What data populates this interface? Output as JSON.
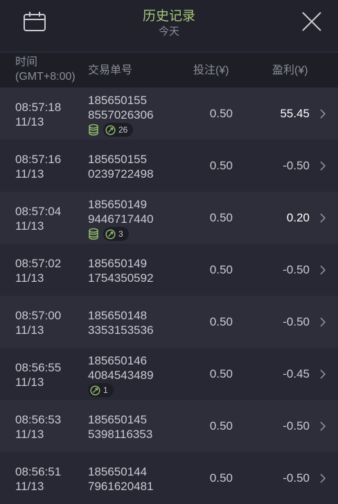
{
  "header": {
    "title": "历史记录",
    "subtitle": "今天",
    "left_icon": "calendar-icon",
    "right_icon": "close-icon"
  },
  "columns": {
    "time_line1": "时间",
    "time_line2": "(GMT+8:00)",
    "order": "交易单号",
    "stake": "投注(¥)",
    "profit": "盈利(¥)"
  },
  "colors": {
    "title": "#a6c87c",
    "background": "#21222b",
    "row_odd": "#2d2e3a",
    "row_even": "#272833",
    "badge_icon": "#8fb86a"
  },
  "rows": [
    {
      "time": "08:57:18",
      "date": "11/13",
      "order1": "185650155",
      "order2": "8557026306",
      "stake": "0.50",
      "profit": "55.45",
      "coins": true,
      "badge": "26"
    },
    {
      "time": "08:57:16",
      "date": "11/13",
      "order1": "185650155",
      "order2": "0239722498",
      "stake": "0.50",
      "profit": "-0.50"
    },
    {
      "time": "08:57:04",
      "date": "11/13",
      "order1": "185650149",
      "order2": "9446717440",
      "stake": "0.50",
      "profit": "0.20",
      "coins": true,
      "badge": "3"
    },
    {
      "time": "08:57:02",
      "date": "11/13",
      "order1": "185650149",
      "order2": "1754350592",
      "stake": "0.50",
      "profit": "-0.50"
    },
    {
      "time": "08:57:00",
      "date": "11/13",
      "order1": "185650148",
      "order2": "3353153536",
      "stake": "0.50",
      "profit": "-0.50"
    },
    {
      "time": "08:56:55",
      "date": "11/13",
      "order1": "185650146",
      "order2": "4084543489",
      "stake": "0.50",
      "profit": "-0.45",
      "coins": false,
      "badge": "1"
    },
    {
      "time": "08:56:53",
      "date": "11/13",
      "order1": "185650145",
      "order2": "5398116353",
      "stake": "0.50",
      "profit": "-0.50"
    },
    {
      "time": "08:56:51",
      "date": "11/13",
      "order1": "185650144",
      "order2": "7961620481",
      "stake": "0.50",
      "profit": "-0.50"
    }
  ]
}
